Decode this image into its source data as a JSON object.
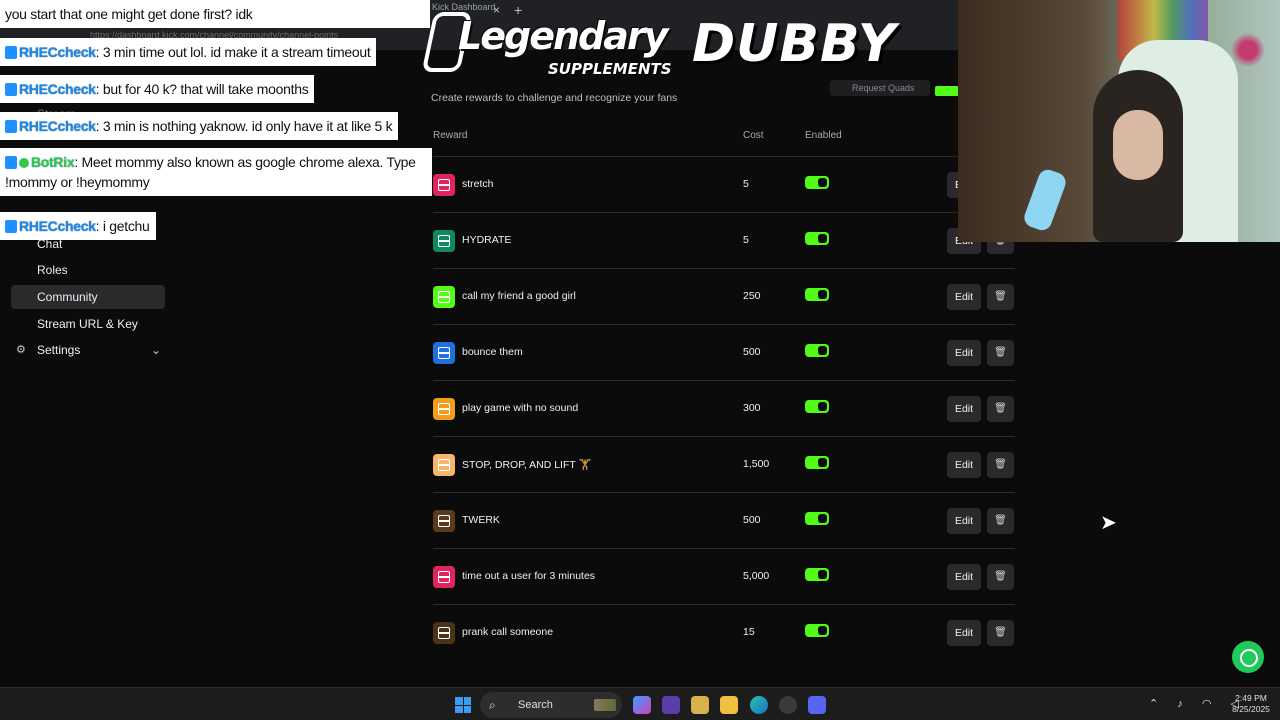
{
  "browser": {
    "tab_title": "Kick Dashboard",
    "url": "https://dashboard.kick.com/channel/community/channel-points"
  },
  "nav": {
    "items": [
      {
        "label": "Stream",
        "partial": true
      },
      {
        "label": "Chat"
      },
      {
        "label": "Roles"
      },
      {
        "label": "Community",
        "active": true
      },
      {
        "label": "Stream URL & Key"
      },
      {
        "label": "Settings"
      }
    ]
  },
  "main": {
    "subtitle": "Create rewards to challenge and recognize your fans",
    "request_button": "Request Quads",
    "headers": {
      "reward": "Reward",
      "cost": "Cost",
      "enabled": "Enabled"
    },
    "edit_label": "Edit",
    "rewards": [
      {
        "name": "stretch",
        "cost": "5",
        "icon_color": "#e0245e",
        "enabled": true
      },
      {
        "name": "HYDRATE",
        "cost": "5",
        "icon_color": "#0f8a5f",
        "enabled": true
      },
      {
        "name": "call my friend a good girl",
        "cost": "250",
        "icon_color": "#53fc18",
        "enabled": true
      },
      {
        "name": "bounce them",
        "cost": "500",
        "icon_color": "#1e6fe0",
        "enabled": true
      },
      {
        "name": "play game with no sound",
        "cost": "300",
        "icon_color": "#f29d1b",
        "enabled": true
      },
      {
        "name": "STOP, DROP, AND LIFT 🏋",
        "cost": "1,500",
        "icon_color": "#f6b56a",
        "enabled": true
      },
      {
        "name": "TWERK",
        "cost": "500",
        "icon_color": "#5a3a1a",
        "enabled": true
      },
      {
        "name": "time out a user for 3 minutes",
        "cost": "5,000",
        "icon_color": "#e0245e",
        "enabled": true
      },
      {
        "name": "prank call someone",
        "cost": "15",
        "icon_color": "#4a3418",
        "enabled": true
      }
    ]
  },
  "chat": {
    "messages": [
      {
        "user": "",
        "text": "you start that one might get done first? idk"
      },
      {
        "user": "RHECcheck",
        "text": ": 3 min time out lol. id make it a stream timeout"
      },
      {
        "user": "RHECcheck",
        "text": ": but for 40 k? that will take moonths"
      },
      {
        "user": "RHECcheck",
        "text": ": 3 min is nothing yaknow. id only have it at like 5 k"
      },
      {
        "user": "BotRix",
        "text": ": Meet mommy also known as google chrome alexa. Type !mommy or !heymommy",
        "verified": true
      },
      {
        "user": "RHECcheck",
        "text": ": i getchu"
      }
    ]
  },
  "sponsors": {
    "legendary_main": "Legendary",
    "legendary_sub": "SUPPLEMENTS",
    "dubby": "DUBBY"
  },
  "taskbar": {
    "search_label": "Search",
    "time": "2:49 PM",
    "date": "8/25/2025"
  },
  "colors": {
    "accent": "#53fc18",
    "background": "#0b0b0c",
    "panel": "#2a2a2d"
  }
}
